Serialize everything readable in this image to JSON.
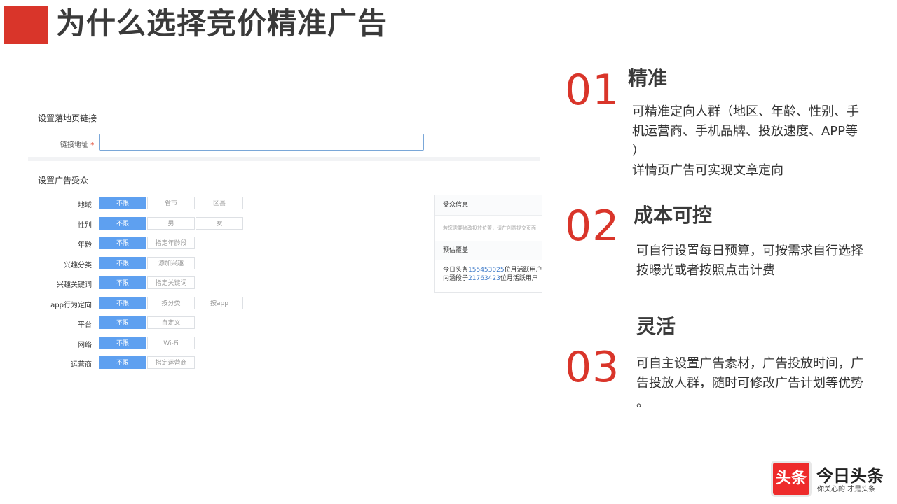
{
  "page_title": "为什么选择竞价精准广告",
  "panel": {
    "section1_title": "设置落地页链接",
    "link_label": "链接地址",
    "required_mark": "*",
    "section2_title": "设置广告受众",
    "rows": [
      {
        "label": "地域",
        "options": [
          "不限",
          "省市",
          "区县"
        ]
      },
      {
        "label": "性别",
        "options": [
          "不限",
          "男",
          "女"
        ]
      },
      {
        "label": "年龄",
        "options": [
          "不限",
          "指定年龄段"
        ]
      },
      {
        "label": "兴趣分类",
        "options": [
          "不限",
          "添加兴趣"
        ]
      },
      {
        "label": "兴趣关键词",
        "options": [
          "不限",
          "指定关键词"
        ]
      },
      {
        "label": "app行为定向",
        "options": [
          "不限",
          "按分类",
          "按app"
        ]
      },
      {
        "label": "平台",
        "options": [
          "不限",
          "自定义"
        ]
      },
      {
        "label": "网络",
        "options": [
          "不限",
          "Wi-Fi"
        ]
      },
      {
        "label": "运营商",
        "options": [
          "不限",
          "指定运营商"
        ]
      }
    ],
    "audience": {
      "header": "受众信息",
      "note": "若您需要修改投放位置，请在创意提交页面",
      "estimate_header": "预估覆盖",
      "line1_prefix": "今日头条",
      "line1_num": "155453025",
      "line1_suffix": "位月活跃用户",
      "line2_prefix": "内涵段子",
      "line2_num": "21763423",
      "line2_suffix": "位月活跃用户"
    }
  },
  "features": [
    {
      "number": "01",
      "title": "精准",
      "lines": [
        "可精准定向人群（地区、年龄、性别、手",
        "机运营商、手机品牌、投放速度、APP等",
        "）",
        "详情页广告可实现文章定向"
      ]
    },
    {
      "number": "02",
      "title": "成本可控",
      "lines": [
        "可自行设置每日预算，可按需求自行选择",
        "按曝光或者按照点击计费"
      ]
    },
    {
      "number": "03",
      "title": "灵活",
      "lines": [
        "可自主设置广告素材，广告投放时间，广",
        "告投放人群，随时可修改广告计划等优势",
        "。"
      ]
    }
  ],
  "logo": {
    "badge": "头条",
    "name": "今日头条",
    "slogan": "你关心的 才是头条"
  },
  "colors": {
    "accent_red": "#d9352a",
    "selected_blue": "#5ea0f0",
    "number_blue": "#3c79c8"
  }
}
